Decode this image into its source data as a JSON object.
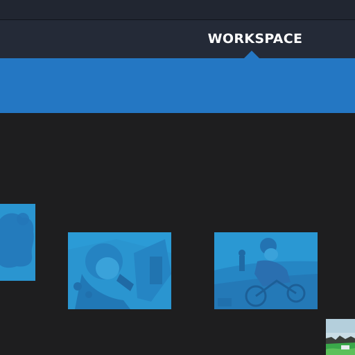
{
  "nav": {
    "tabs": [
      {
        "label": "WORKSPACE",
        "active": true
      }
    ]
  },
  "colors": {
    "topbar": "#212631",
    "navbar": "#242a37",
    "banner_blue": "#2477c3",
    "content_bg": "#1e1e1f",
    "thumb_tint": "#2a95d0"
  },
  "gallery": {
    "items": [
      {
        "name": "blue-blob-thumbnail"
      },
      {
        "name": "pilot-cockpit-thumbnail"
      },
      {
        "name": "cyclist-thumbnail"
      },
      {
        "name": "landscape-thumbnail"
      }
    ]
  }
}
